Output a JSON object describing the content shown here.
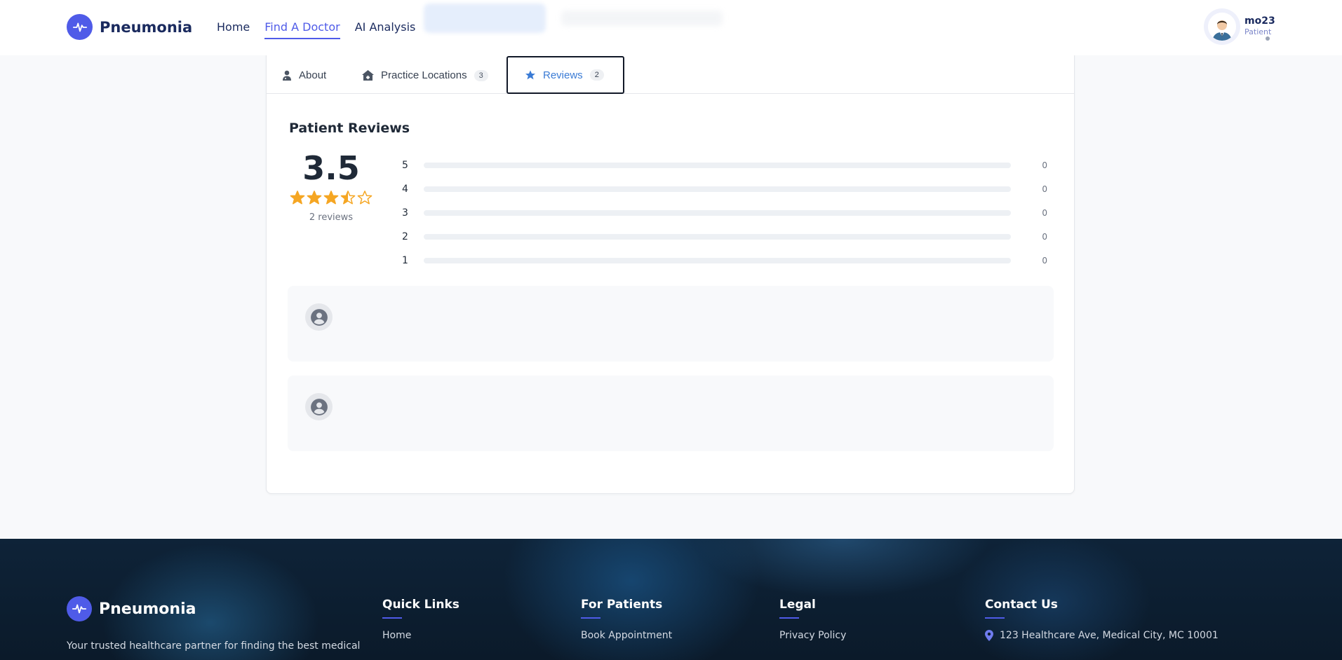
{
  "navbar": {
    "brand": "Pneumonia",
    "links": [
      {
        "label": "Home",
        "active": false
      },
      {
        "label": "Find A Doctor",
        "active": true
      },
      {
        "label": "AI Analysis",
        "active": false
      }
    ],
    "user": {
      "name": "mo23",
      "role": "Patient"
    }
  },
  "tabs": [
    {
      "label": "About",
      "icon": "user-doctor-icon"
    },
    {
      "label": "Practice Locations",
      "icon": "clinic-house-icon",
      "count": "3"
    },
    {
      "label": "Reviews",
      "icon": "star-icon",
      "count": "2",
      "active": true
    }
  ],
  "reviews": {
    "title": "Patient Reviews",
    "average": "3.5",
    "rating_value": 3.5,
    "count_label": "2 reviews",
    "distribution": [
      {
        "stars": "5",
        "count": "0",
        "fraction": 0
      },
      {
        "stars": "4",
        "count": "0",
        "fraction": 0
      },
      {
        "stars": "3",
        "count": "0",
        "fraction": 0
      },
      {
        "stars": "2",
        "count": "0",
        "fraction": 0
      },
      {
        "stars": "1",
        "count": "0",
        "fraction": 0
      }
    ],
    "items": [
      {
        "avatar": "user-circle-icon"
      },
      {
        "avatar": "user-circle-icon"
      }
    ]
  },
  "footer": {
    "brand": "Pneumonia",
    "tagline": "Your trusted healthcare partner for finding the best medical",
    "columns": [
      {
        "heading": "Quick Links",
        "links": [
          "Home"
        ]
      },
      {
        "heading": "For Patients",
        "links": [
          "Book Appointment"
        ]
      },
      {
        "heading": "Legal",
        "links": [
          "Privacy Policy"
        ]
      },
      {
        "heading": "Contact Us",
        "links": [
          "123 Healthcare Ave, Medical City, MC 10001"
        ]
      }
    ]
  },
  "colors": {
    "accent": "#4f5be8",
    "star": "#f5a623",
    "reviews_tab": "#3a7bd5",
    "footer_bg": "#0b1a2a"
  }
}
